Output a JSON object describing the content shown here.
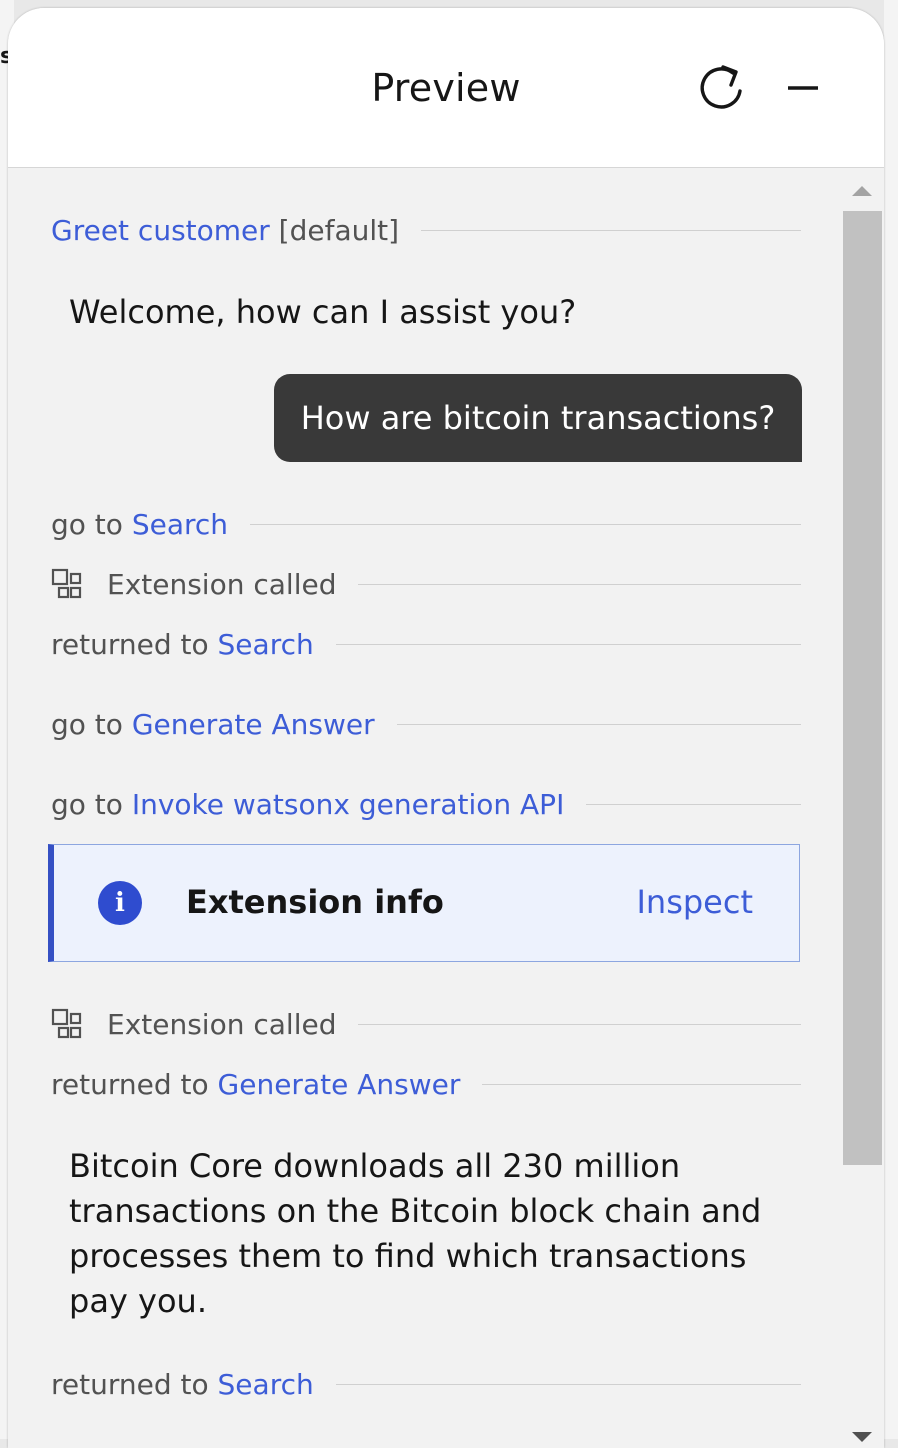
{
  "window": {
    "title": "Preview",
    "refresh_icon": "refresh-icon",
    "minimize_icon": "minimize-icon",
    "background_fragment": "s"
  },
  "conversation": {
    "greet": {
      "link": "Greet customer",
      "suffix": " [default]"
    },
    "welcome_message": "Welcome, how can I assist you?",
    "user_message": "How are bitcoin transactions?",
    "events": [
      {
        "prefix": "go to ",
        "link": "Search"
      },
      {
        "icon": "extension-icon",
        "text": "Extension called"
      },
      {
        "prefix": "returned to ",
        "link": "Search"
      },
      {
        "prefix": "go to ",
        "link": "Generate Answer"
      },
      {
        "prefix": "go to ",
        "link": "Invoke watsonx generation API"
      },
      {
        "icon": "extension-icon",
        "text": "Extension called"
      },
      {
        "prefix": "returned to ",
        "link": "Generate Answer"
      },
      {
        "prefix": "returned to ",
        "link": "Search"
      }
    ],
    "extension_info": {
      "icon": "info-icon",
      "title": "Extension info",
      "action": "Inspect"
    },
    "answer": "Bitcoin Core downloads all 230 million transactions on the Bitcoin block chain and processes them to find which transactions pay you."
  },
  "colors": {
    "link": "#3d5dd7",
    "user_bubble": "#393939",
    "info_accent": "#3550c4"
  }
}
